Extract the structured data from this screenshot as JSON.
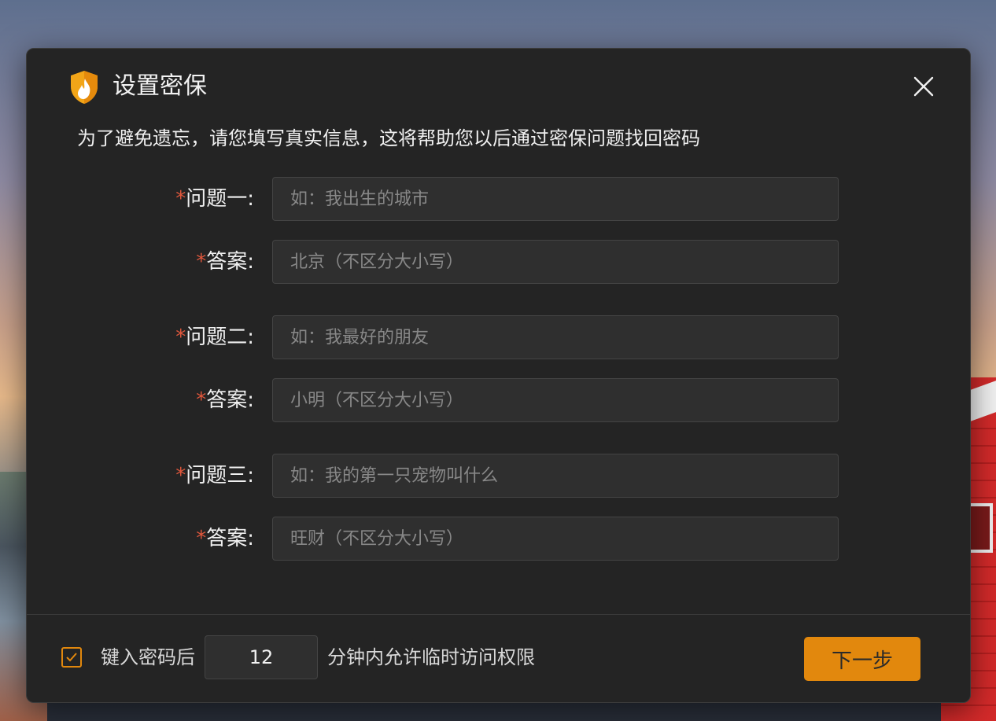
{
  "dialog": {
    "title": "设置密保",
    "subtitle": "为了避免遗忘，请您填写真实信息，这将帮助您以后通过密保问题找回密码"
  },
  "questions": [
    {
      "required_mark": "*",
      "question_label": "问题一:",
      "question_placeholder": "如：我出生的城市",
      "answer_label": "答案:",
      "answer_placeholder": "北京（不区分大小写）"
    },
    {
      "required_mark": "*",
      "question_label": "问题二:",
      "question_placeholder": "如：我最好的朋友",
      "answer_label": "答案:",
      "answer_placeholder": "小明（不区分大小写）"
    },
    {
      "required_mark": "*",
      "question_label": "问题三:",
      "question_placeholder": "如：我的第一只宠物叫什么",
      "answer_label": "答案:",
      "answer_placeholder": "旺财（不区分大小写）"
    }
  ],
  "footer": {
    "checkbox_checked": true,
    "text_before": "键入密码后",
    "minutes_value": "12",
    "text_after": "分钟内允许临时访问权限",
    "next_button": "下一步"
  },
  "colors": {
    "accent": "#e2880d",
    "required": "#e0573c",
    "dialog_bg": "#242424",
    "input_bg": "#2f2f2f"
  },
  "icons": {
    "logo": "flame-shield-icon",
    "close": "close-icon",
    "check": "checkmark-icon"
  }
}
